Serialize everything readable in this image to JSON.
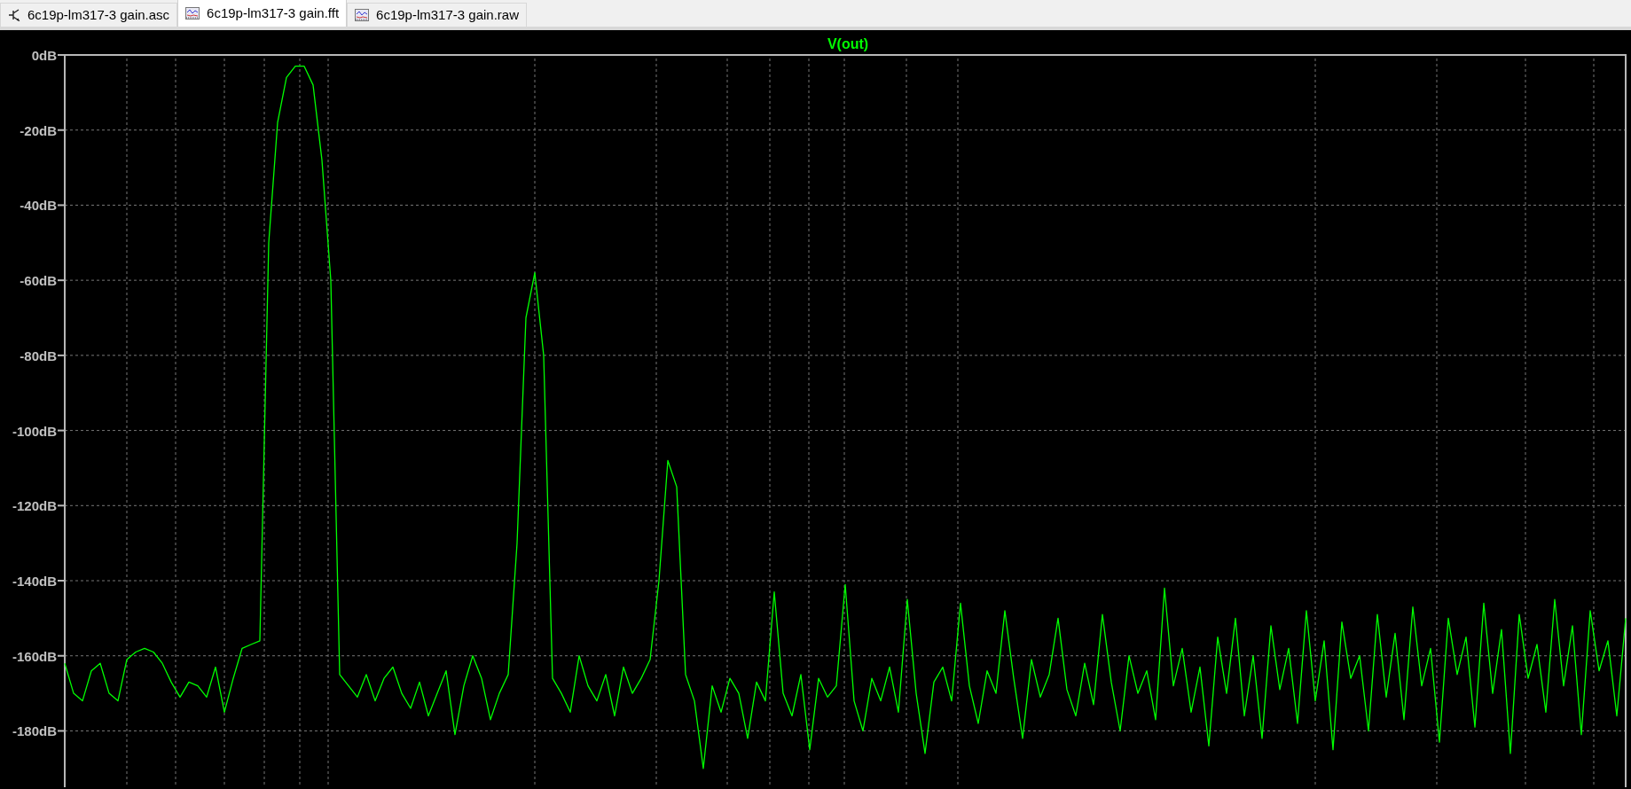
{
  "tabs": [
    {
      "label": "6c19p-lm317-3 gain.asc",
      "kind": "schematic",
      "selected": false
    },
    {
      "label": "6c19p-lm317-3 gain.fft",
      "kind": "waveform",
      "selected": true
    },
    {
      "label": "6c19p-lm317-3 gain.raw",
      "kind": "waveform",
      "selected": false
    }
  ],
  "plot": {
    "chart_data": {
      "type": "line",
      "grid": true,
      "ylim": [
        -195,
        0
      ],
      "yticks": [
        {
          "value": 0,
          "label": "0dB"
        },
        {
          "value": -20,
          "label": "-20dB"
        },
        {
          "value": -40,
          "label": "-40dB"
        },
        {
          "value": -60,
          "label": "-60dB"
        },
        {
          "value": -80,
          "label": "-80dB"
        },
        {
          "value": -100,
          "label": "-100dB"
        },
        {
          "value": -120,
          "label": "-120dB"
        },
        {
          "value": -140,
          "label": "-140dB"
        },
        {
          "value": -160,
          "label": "-160dB"
        },
        {
          "value": -180,
          "label": "-180dB"
        }
      ],
      "series": [
        {
          "name": "V(out)",
          "color": "#00ff00",
          "values": [
            -162,
            -170,
            -172,
            -164,
            -162,
            -170,
            -172,
            -161,
            -159,
            -158,
            -159,
            -162,
            -167,
            -171,
            -167,
            -168,
            -171,
            -163,
            -175,
            -166,
            -158,
            -157,
            -156,
            -50,
            -18,
            -6,
            -3,
            -3,
            -8,
            -28,
            -60,
            -165,
            -168,
            -171,
            -165,
            -172,
            -166,
            -163,
            -170,
            -174,
            -167,
            -176,
            -170,
            -164,
            -181,
            -168,
            -160,
            -166,
            -177,
            -170,
            -165,
            -130,
            -70,
            -58,
            -80,
            -166,
            -170,
            -175,
            -160,
            -168,
            -172,
            -165,
            -176,
            -163,
            -170,
            -166,
            -161,
            -140,
            -108,
            -115,
            -165,
            -172,
            -190,
            -168,
            -175,
            -166,
            -170,
            -182,
            -167,
            -172,
            -143,
            -170,
            -176,
            -165,
            -185,
            -166,
            -171,
            -168,
            -141,
            -172,
            -180,
            -166,
            -172,
            -163,
            -175,
            -145,
            -170,
            -186,
            -167,
            -163,
            -172,
            -146,
            -168,
            -178,
            -164,
            -170,
            -148,
            -166,
            -182,
            -161,
            -171,
            -165,
            -150,
            -169,
            -176,
            -162,
            -173,
            -149,
            -167,
            -180,
            -160,
            -170,
            -164,
            -177,
            -142,
            -168,
            -158,
            -175,
            -163,
            -184,
            -155,
            -170,
            -150,
            -176,
            -160,
            -182,
            -152,
            -169,
            -158,
            -178,
            -148,
            -172,
            -156,
            -185,
            -151,
            -166,
            -160,
            -180,
            -149,
            -171,
            -154,
            -177,
            -147,
            -168,
            -158,
            -183,
            -150,
            -165,
            -155,
            -179,
            -146,
            -170,
            -153,
            -186,
            -149,
            -166,
            -157,
            -175,
            -145,
            -168,
            -152,
            -181,
            -148,
            -164,
            -156,
            -176,
            -150
          ]
        }
      ]
    }
  }
}
